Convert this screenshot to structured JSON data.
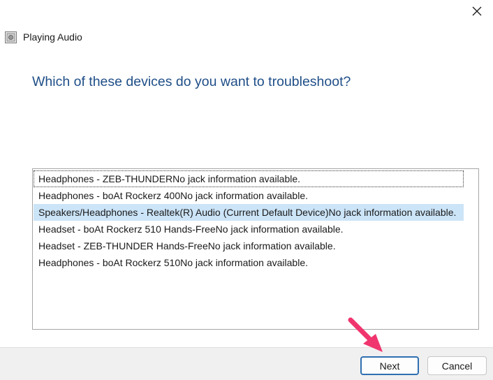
{
  "window": {
    "title": "Playing Audio",
    "close_icon": "close-icon",
    "app_icon": "speaker-app-icon"
  },
  "main": {
    "question": "Which of these devices do you want to troubleshoot?"
  },
  "devices": [
    "Headphones - ZEB-THUNDERNo jack information available.",
    "Headphones - boAt Rockerz 400No jack information available.",
    "Speakers/Headphones - Realtek(R) Audio (Current Default Device)No jack information available.",
    "Headset - boAt Rockerz 510 Hands-FreeNo jack information available.",
    "Headset - ZEB-THUNDER Hands-FreeNo jack information available.",
    "Headphones - boAt Rockerz 510No jack information available."
  ],
  "selected_device_index": 2,
  "footer": {
    "next_label": "Next",
    "cancel_label": "Cancel"
  },
  "colors": {
    "question_text": "#1f4e88",
    "selection_bg": "#cce4f7",
    "next_border": "#2f6fb0",
    "footer_bg": "#f0f0f0",
    "annotation_arrow": "#f0356e"
  }
}
